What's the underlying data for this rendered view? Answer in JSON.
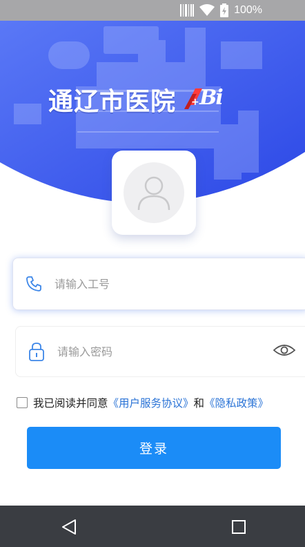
{
  "status_bar": {
    "battery_text": "100%"
  },
  "hero": {
    "title": "通辽市医院",
    "logo_letters": "Bi"
  },
  "form": {
    "employee_id_placeholder": "请输入工号",
    "password_placeholder": "请输入密码"
  },
  "agreement": {
    "prefix": "我已阅读并同意",
    "service_link": "《用户服务协议》",
    "joiner": "和",
    "privacy_link": "《隐私政策》"
  },
  "login_button": {
    "label": "登录"
  },
  "colors": {
    "primary": "#1b8cf7",
    "hero_blue": "#3d5ef0",
    "link": "#2a73d6"
  }
}
